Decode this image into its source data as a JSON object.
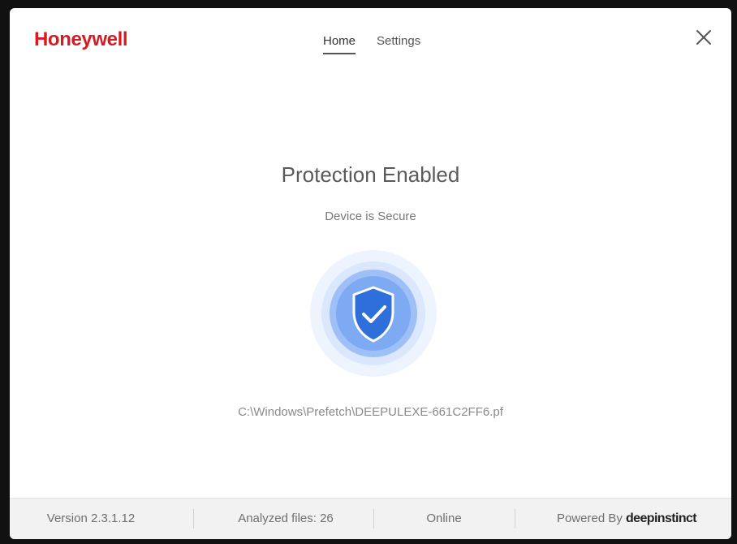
{
  "app": {
    "brand": "Honeywell"
  },
  "nav": {
    "tabs": [
      "Home",
      "Settings"
    ]
  },
  "status": {
    "title": "Protection Enabled",
    "subtitle": "Device is Secure",
    "file": "C:\\Windows\\Prefetch\\DEEPULEXE-661C2FF6.pf"
  },
  "footer": {
    "version": "Version 2.3.1.12",
    "analyzed": "Analyzed files: 26",
    "connection": "Online",
    "powered_prefix": "Powered By",
    "powered_brand": "deepinstinct"
  },
  "colors": {
    "brand": "#d71921",
    "shield": "#2f6fdc",
    "halo": "#dbe7fd"
  },
  "icons": {
    "close": "close-icon",
    "shield": "shield-check-icon"
  }
}
